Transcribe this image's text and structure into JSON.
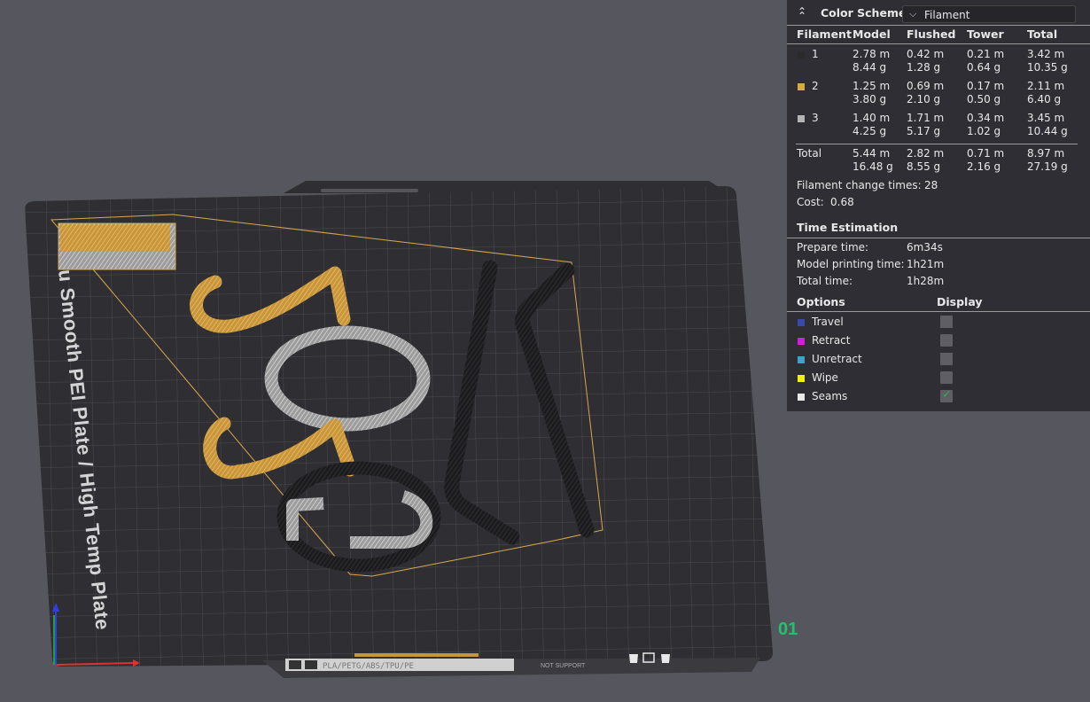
{
  "color_scheme": {
    "title": "Color Scheme",
    "selected": "Filament"
  },
  "filament_table": {
    "headers": [
      "Filament",
      "Model",
      "Flushed",
      "Tower",
      "Total"
    ],
    "rows": [
      {
        "id": "1",
        "color": "#2a2a2a",
        "model": [
          "2.78 m",
          "8.44 g"
        ],
        "flushed": [
          "0.42 m",
          "1.28 g"
        ],
        "tower": [
          "0.21 m",
          "0.64 g"
        ],
        "total": [
          "3.42 m",
          "10.35 g"
        ]
      },
      {
        "id": "2",
        "color": "#d9a84c",
        "model": [
          "1.25 m",
          "3.80 g"
        ],
        "flushed": [
          "0.69 m",
          "2.10 g"
        ],
        "tower": [
          "0.17 m",
          "0.50 g"
        ],
        "total": [
          "2.11 m",
          "6.40 g"
        ]
      },
      {
        "id": "3",
        "color": "#b4b4b4",
        "model": [
          "1.40 m",
          "4.25 g"
        ],
        "flushed": [
          "1.71 m",
          "5.17 g"
        ],
        "tower": [
          "0.34 m",
          "1.02 g"
        ],
        "total": [
          "3.45 m",
          "10.44 g"
        ]
      }
    ],
    "total_row": {
      "label": "Total",
      "model": [
        "5.44 m",
        "16.48 g"
      ],
      "flushed": [
        "2.82 m",
        "8.55 g"
      ],
      "tower": [
        "0.71 m",
        "2.16 g"
      ],
      "total": [
        "8.97 m",
        "27.19 g"
      ]
    }
  },
  "filament_change": {
    "label": "Filament change times:",
    "value": "28"
  },
  "cost": {
    "label": "Cost:",
    "value": "0.68"
  },
  "time_estimation": {
    "title": "Time Estimation",
    "rows": [
      {
        "label": "Prepare time:",
        "value": "6m34s"
      },
      {
        "label": "Model printing time:",
        "value": "1h21m"
      },
      {
        "label": "Total time:",
        "value": "1h28m"
      }
    ]
  },
  "options": {
    "header_options": "Options",
    "header_display": "Display",
    "items": [
      {
        "label": "Travel",
        "color": "#3a4aa6",
        "checked": false
      },
      {
        "label": "Retract",
        "color": "#d21fd2",
        "checked": false
      },
      {
        "label": "Unretract",
        "color": "#3aa6cc",
        "checked": false
      },
      {
        "label": "Wipe",
        "color": "#f0f000",
        "checked": false
      },
      {
        "label": "Seams",
        "color": "#eaeaea",
        "checked": true
      }
    ]
  },
  "plate": {
    "label_text": "u Smooth PEI Plate / High Temp Plate",
    "plate_number": "01",
    "toolbar_text": "PLA/PETG/ABS/TPU/PE",
    "toolbar_sub": "NOT\nSUPPORT"
  },
  "colors": {
    "background": "#56565e",
    "plate": "#2f2f33",
    "gold": "#d9a84c",
    "gray": "#b4b4b4",
    "dark": "#222224",
    "accent_green": "#1fc46a"
  }
}
